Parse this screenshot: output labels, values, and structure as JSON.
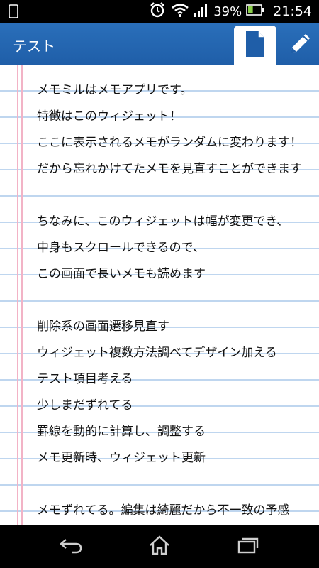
{
  "status_bar": {
    "battery_percent": "39%",
    "time": "21:54",
    "battery_level": 0.39
  },
  "app": {
    "title": "テスト"
  },
  "icons": {
    "notification": "sd-card-icon",
    "alarm": "alarm-icon",
    "wifi": "wifi-icon",
    "signal": "signal-icon",
    "battery": "battery-icon",
    "memo_tab": "document-icon",
    "edit": "pencil-icon",
    "back": "back-icon",
    "home": "home-icon",
    "recent": "recent-apps-icon"
  },
  "colors": {
    "action_bar": "#1f5ea8",
    "ruled_line": "#bfd6ef",
    "margin_line": "#f2b3c6",
    "battery_fill": "#8bd04a"
  },
  "note": {
    "lines": [
      "メモミルはメモアプリです。",
      "特徴はこのウィジェット！",
      "ここに表示されるメモがランダムに変わります！",
      "だから忘れかけてたメモを見直すことができます",
      "",
      "ちなみに、このウィジェットは幅が変更でき、",
      "中身もスクロールできるので、",
      "この画面で長いメモも読めます",
      "",
      "削除系の画面遷移見直す",
      "ウィジェット複数方法調べてデザイン加える",
      "テスト項目考える",
      "少しまだずれてる",
      "罫線を動的に計算し、調整する",
      "メモ更新時、ウィジェット更新",
      "",
      "メモずれてる。編集は綺麗だから不一致の予感"
    ]
  }
}
